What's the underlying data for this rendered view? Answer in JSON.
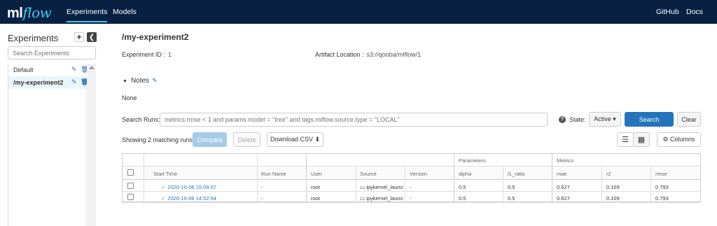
{
  "nav": {
    "logo_ml": "ml",
    "logo_flow": "flow",
    "experiments": "Experiments",
    "models": "Models",
    "github": "GitHub",
    "docs": "Docs",
    "accent": "#43c9ed",
    "bg": "#082142"
  },
  "sidebar": {
    "title": "Experiments",
    "add_icon": "+",
    "collapse_icon": "❮",
    "search_placeholder": "Search Experiments",
    "items": [
      {
        "label": "Default"
      },
      {
        "label": "/my-experiment2"
      }
    ],
    "edit_icon": "✎",
    "delete_icon": "🗑"
  },
  "experiment": {
    "title": "/my-experiment2",
    "id_label": "Experiment ID :",
    "id_value": "1",
    "artifact_label": "Artifact Location :",
    "artifact_value": "s3://qooba/mlflow/1",
    "notes_label": "Notes",
    "notes_caret": "▼",
    "notes_edit_icon": "✎",
    "notes_text": "None"
  },
  "search": {
    "label": "Search Runs:",
    "placeholder": "metrics.rmse < 1 and params.model = \"tree\" and tags.mlflow.source.type = \"LOCAL\"",
    "help_icon": "?",
    "state_label": "State:",
    "state_value": "Active ▾",
    "search_button": "Search",
    "clear_button": "Clear"
  },
  "toolbar": {
    "matching": "Showing 2 matching runs",
    "compare": "Compare",
    "delete": "Delete",
    "download": "Download CSV ⬇",
    "list_icon": "☰",
    "grid_icon": "▦",
    "columns": "⚙ Columns"
  },
  "table": {
    "groups": {
      "parameters": "Parameters",
      "metrics": "Metrics"
    },
    "headers": {
      "start_time": "Start Time",
      "run_name": "Run Name",
      "user": "User",
      "source": "Source",
      "version": "Version",
      "alpha": "alpha",
      "l1_ratio": "l1_ratio",
      "mae": "mae",
      "r2": "r2",
      "rmse": "rmse"
    },
    "rows": [
      {
        "start_time": "2020-10-06 15:09:07",
        "run_name": "-",
        "user": "root",
        "source": "ipykernel_launcher",
        "version": "-",
        "alpha": "0.5",
        "l1_ratio": "0.5",
        "mae": "0.627",
        "r2": "0.109",
        "rmse": "0.793"
      },
      {
        "start_time": "2020-10-06 14:52:54",
        "run_name": "-",
        "user": "root",
        "source": "ipykernel_launcher",
        "version": "-",
        "alpha": "0.5",
        "l1_ratio": "0.5",
        "mae": "0.627",
        "r2": "0.109",
        "rmse": "0.793"
      }
    ],
    "status_icon": "✓",
    "source_icon": "▭"
  }
}
